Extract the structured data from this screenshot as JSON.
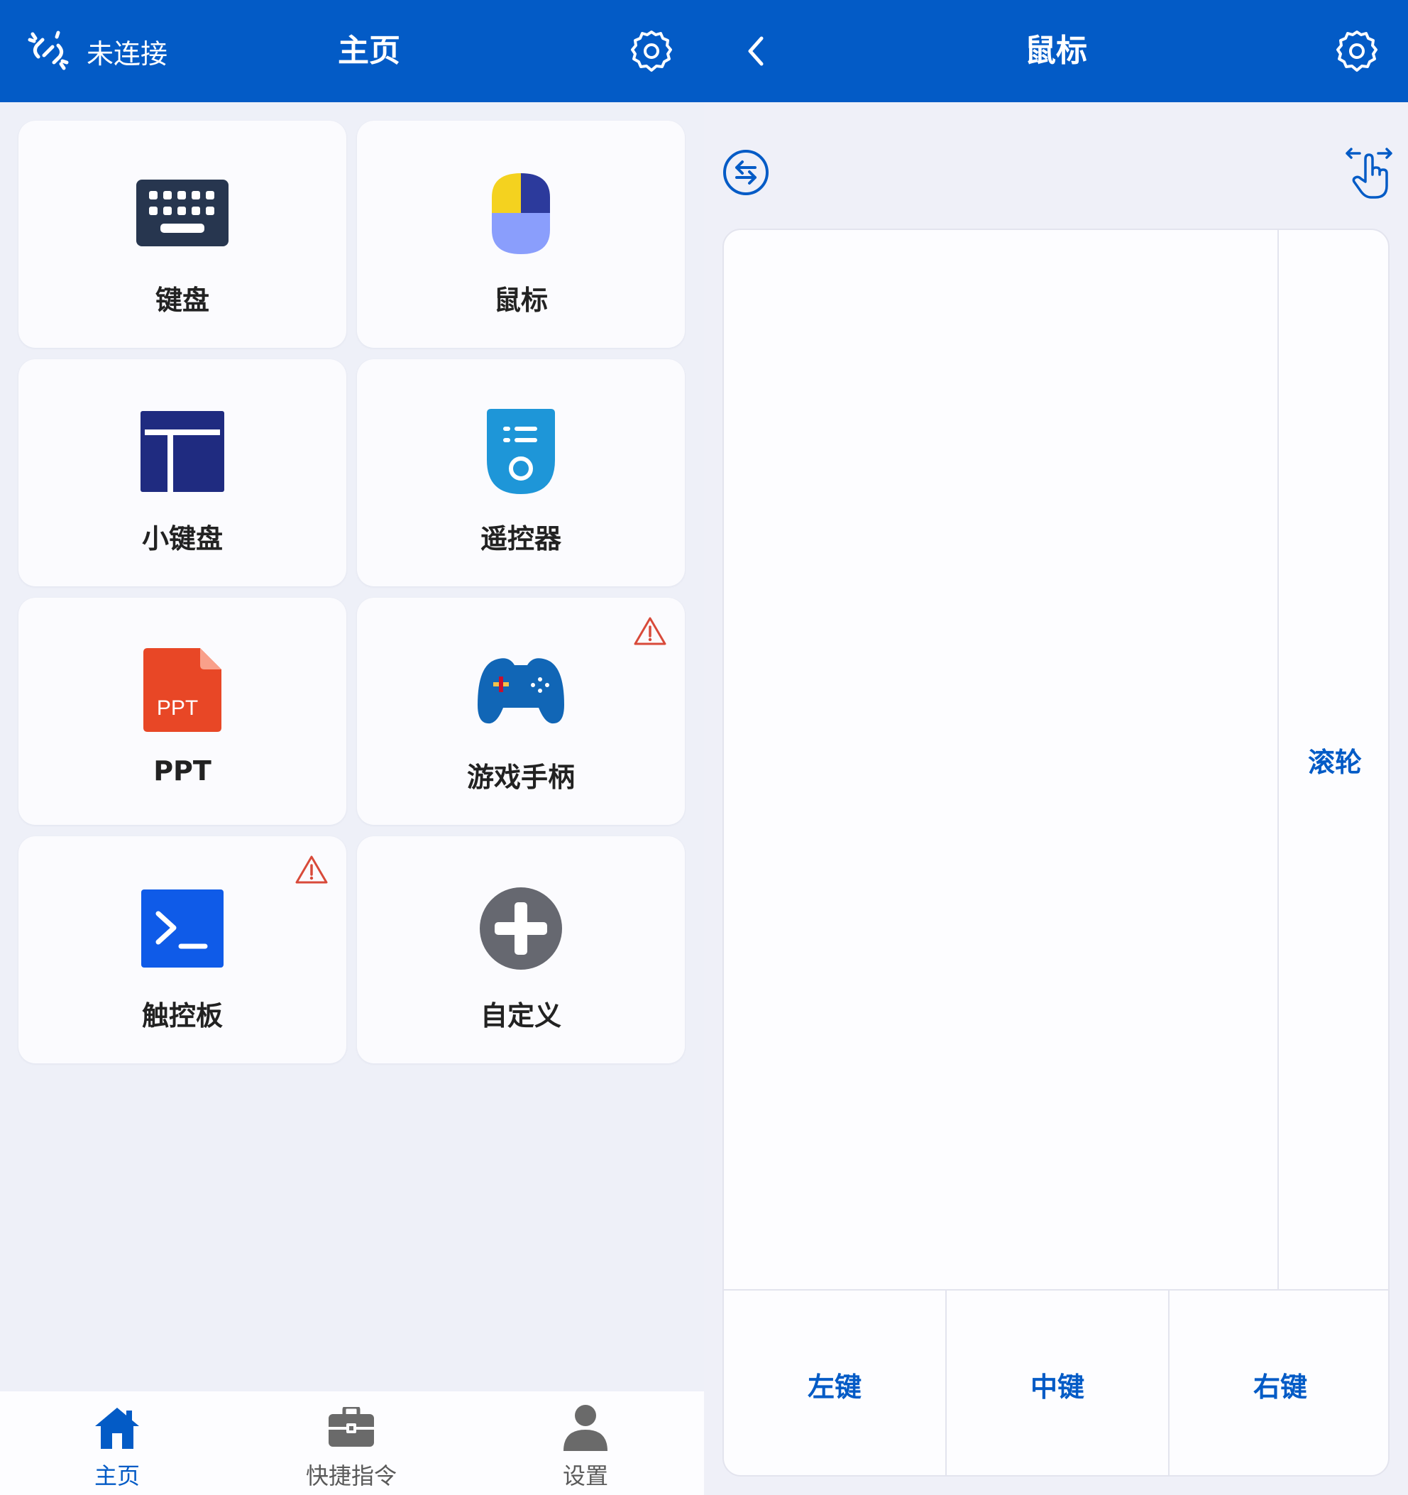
{
  "colors": {
    "primary": "#035bc6",
    "background": "#eef0f8",
    "card": "#fbfbfe",
    "warning": "#d84a3a"
  },
  "home": {
    "connection_status": "未连接",
    "title": "主页",
    "settings_icon": "gear-icon",
    "cards": [
      {
        "label": "键盘",
        "icon": "keyboard-icon",
        "warning": false
      },
      {
        "label": "鼠标",
        "icon": "mouse-icon",
        "warning": false
      },
      {
        "label": "小键盘",
        "icon": "numpad-icon",
        "warning": false
      },
      {
        "label": "遥控器",
        "icon": "remote-icon",
        "warning": false
      },
      {
        "label": "PPT",
        "icon": "ppt-icon",
        "warning": false
      },
      {
        "label": "游戏手柄",
        "icon": "gamepad-icon",
        "warning": true
      },
      {
        "label": "触控板",
        "icon": "terminal-icon",
        "warning": true
      },
      {
        "label": "自定义",
        "icon": "add-circle-icon",
        "warning": false
      }
    ],
    "ppt_badge": "PPT",
    "bottom_nav": [
      {
        "label": "主页",
        "icon": "home-icon",
        "active": true
      },
      {
        "label": "快捷指令",
        "icon": "toolbox-icon",
        "active": false
      },
      {
        "label": "设置",
        "icon": "person-icon",
        "active": false
      }
    ]
  },
  "mouse": {
    "title": "鼠标",
    "scroll_label": "滚轮",
    "buttons": {
      "left": "左键",
      "middle": "中键",
      "right": "右键"
    }
  }
}
